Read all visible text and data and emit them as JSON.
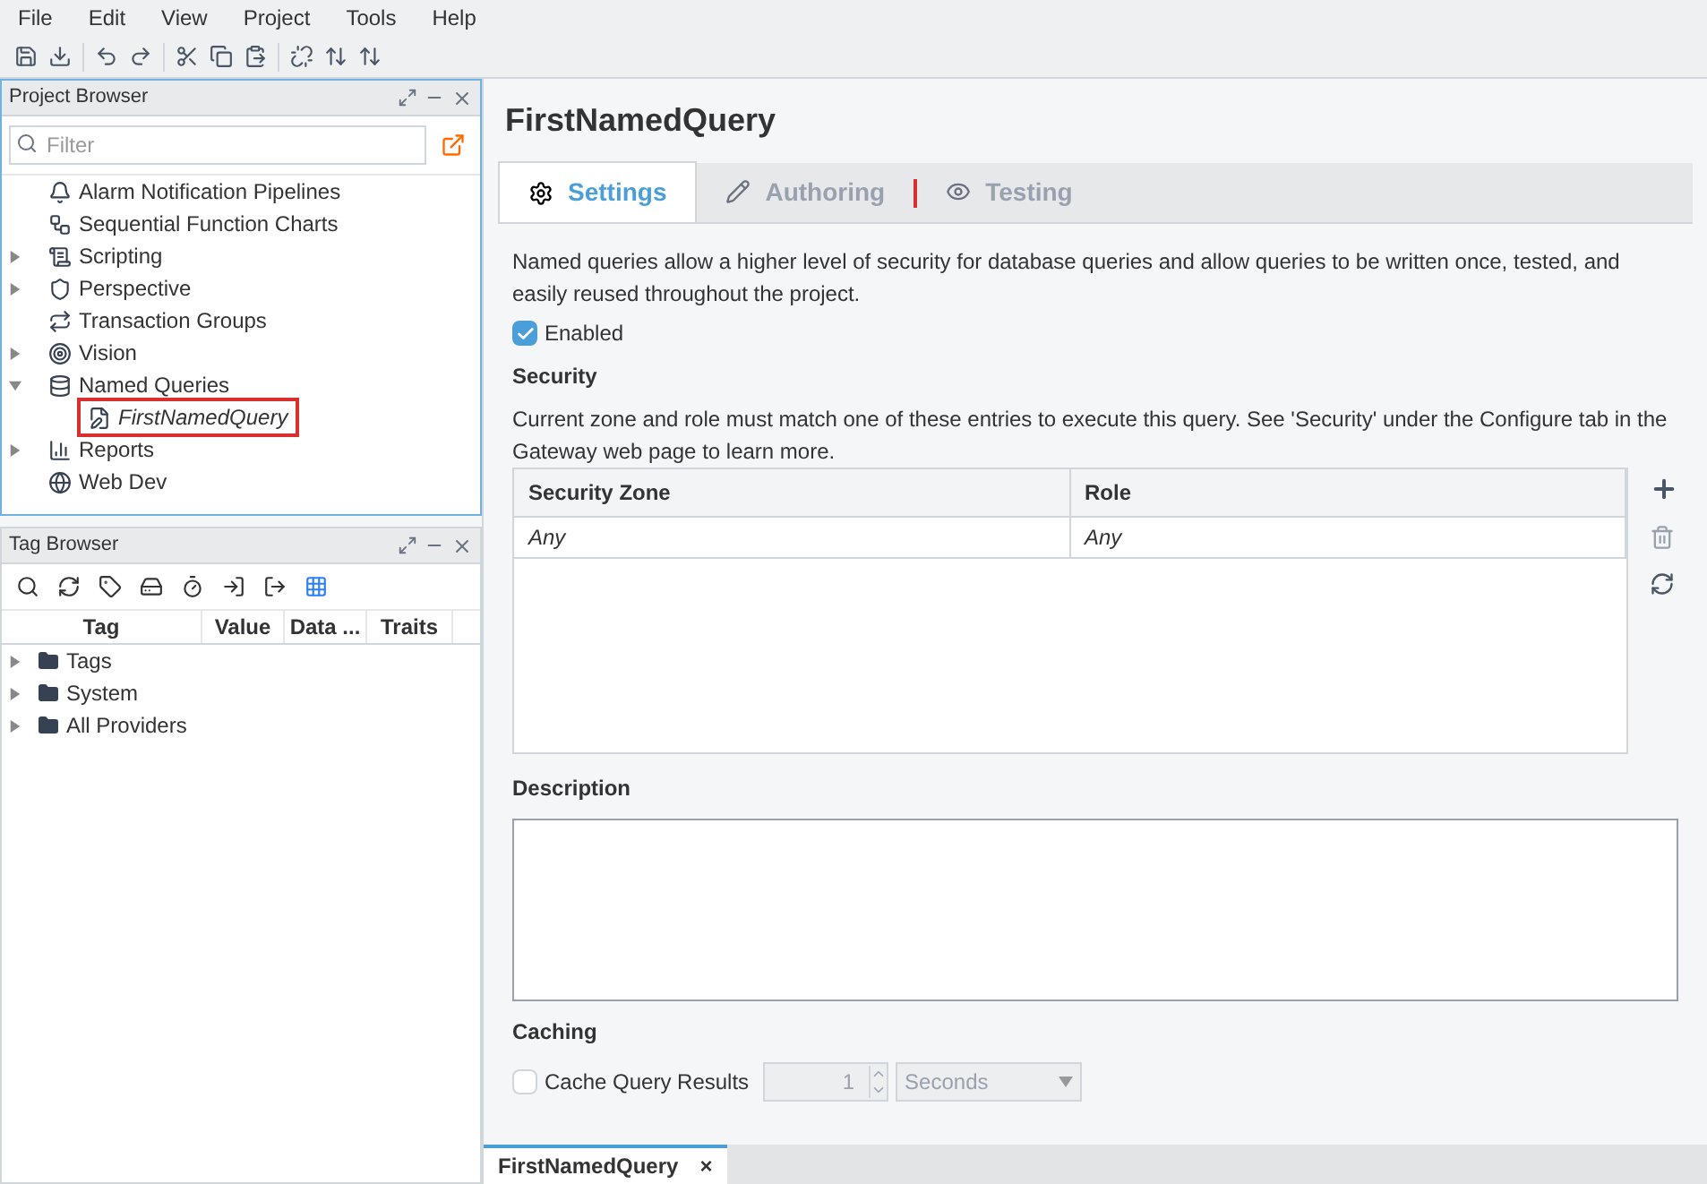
{
  "menu": [
    "File",
    "Edit",
    "View",
    "Project",
    "Tools",
    "Help"
  ],
  "project_browser": {
    "title": "Project Browser",
    "filter_placeholder": "Filter",
    "items": [
      {
        "label": "Alarm Notification Pipelines",
        "kind": "alarm"
      },
      {
        "label": "Sequential Function Charts",
        "kind": "sfc"
      },
      {
        "label": "Scripting",
        "kind": "script",
        "expanded": false
      },
      {
        "label": "Perspective",
        "kind": "perspective",
        "expanded": false
      },
      {
        "label": "Transaction Groups",
        "kind": "transaction"
      },
      {
        "label": "Vision",
        "kind": "vision",
        "expanded": false
      },
      {
        "label": "Named Queries",
        "kind": "queries",
        "expanded": true,
        "children": [
          {
            "label": "FirstNamedQuery",
            "kind": "query",
            "selected": true
          }
        ]
      },
      {
        "label": "Reports",
        "kind": "reports",
        "expanded": false
      },
      {
        "label": "Web Dev",
        "kind": "web"
      }
    ]
  },
  "tag_browser": {
    "title": "Tag Browser",
    "columns": [
      "Tag",
      "Value",
      "Data ...",
      "Traits"
    ],
    "rows": [
      {
        "label": "Tags",
        "expanded": false
      },
      {
        "label": "System",
        "expanded": false
      },
      {
        "label": "All Providers",
        "expanded": false
      }
    ]
  },
  "editor": {
    "title": "FirstNamedQuery",
    "tabs": [
      {
        "label": "Settings",
        "selected": true
      },
      {
        "label": "Authoring",
        "selected": false
      },
      {
        "label": "Testing",
        "selected": false
      }
    ],
    "intro": "Named queries allow a higher level of security for database queries and allow queries to be written once, tested, and easily reused throughout the project.",
    "enabled": {
      "label": "Enabled",
      "checked": true
    },
    "security": {
      "heading": "Security",
      "note": "Current zone and role must match one of these entries to execute this query. See 'Security' under the Configure tab in the Gateway web page to learn more.",
      "columns": [
        "Security Zone",
        "Role"
      ],
      "rows": [
        [
          "Any",
          "Any"
        ]
      ]
    },
    "description": {
      "heading": "Description"
    },
    "caching": {
      "heading": "Caching",
      "label": "Cache Query Results",
      "checked": false,
      "amount": "1",
      "unit": "Seconds"
    }
  },
  "document_tabs": [
    {
      "label": "FirstNamedQuery",
      "close": "×",
      "selected": true
    }
  ]
}
